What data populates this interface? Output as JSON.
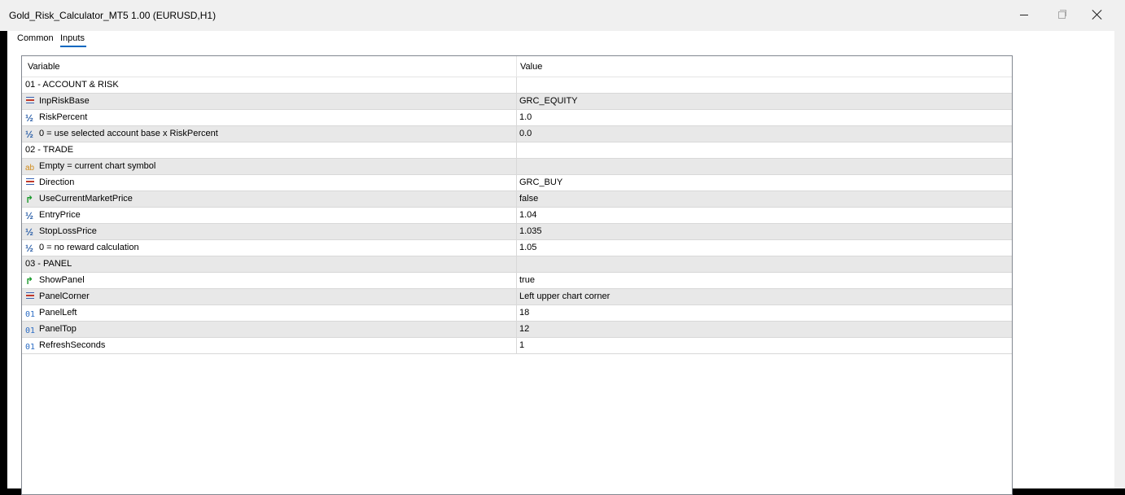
{
  "window": {
    "title": "Gold_Risk_Calculator_MT5 1.00 (EURUSD,H1)"
  },
  "tabs": [
    {
      "label": "Common"
    },
    {
      "label": "Inputs"
    }
  ],
  "grid": {
    "columns": [
      "Variable",
      "Value"
    ],
    "rows": [
      {
        "type": "group",
        "variable": "01 - ACCOUNT & RISK",
        "value": ""
      },
      {
        "type": "enum",
        "icon": "enum-icon",
        "variable": "InpRiskBase",
        "value": "GRC_EQUITY"
      },
      {
        "type": "double",
        "icon": "double-icon",
        "variable": "RiskPercent",
        "value": "1.0"
      },
      {
        "type": "double",
        "icon": "double-icon",
        "variable": "0 = use selected account base x RiskPercent",
        "value": "0.0"
      },
      {
        "type": "group",
        "variable": "02 - TRADE",
        "value": ""
      },
      {
        "type": "string",
        "icon": "string-icon",
        "variable": "Empty = current chart symbol",
        "value": ""
      },
      {
        "type": "enum",
        "icon": "enum-icon",
        "variable": "Direction",
        "value": "GRC_BUY"
      },
      {
        "type": "bool",
        "icon": "bool-icon",
        "variable": "UseCurrentMarketPrice",
        "value": "false"
      },
      {
        "type": "double",
        "icon": "double-icon",
        "variable": "EntryPrice",
        "value": "1.04"
      },
      {
        "type": "double",
        "icon": "double-icon",
        "variable": "StopLossPrice",
        "value": "1.035"
      },
      {
        "type": "double",
        "icon": "double-icon",
        "variable": "0 = no reward calculation",
        "value": "1.05"
      },
      {
        "type": "group",
        "variable": "03 - PANEL",
        "value": ""
      },
      {
        "type": "bool",
        "icon": "bool-icon",
        "variable": "ShowPanel",
        "value": "true"
      },
      {
        "type": "enum",
        "icon": "enum-icon",
        "variable": "PanelCorner",
        "value": "Left upper chart corner"
      },
      {
        "type": "int",
        "icon": "int-icon",
        "variable": "PanelLeft",
        "value": "18"
      },
      {
        "type": "int",
        "icon": "int-icon",
        "variable": "PanelTop",
        "value": "12"
      },
      {
        "type": "int",
        "icon": "int-icon",
        "variable": "RefreshSeconds",
        "value": "1"
      }
    ]
  },
  "icons": {
    "double_glyph": "½",
    "string_glyph": "ab",
    "bool_glyph": "↱",
    "int_glyph": "01"
  },
  "colors": {
    "row_alt": "#e8e8e8",
    "tab_accent": "#0067c0"
  }
}
